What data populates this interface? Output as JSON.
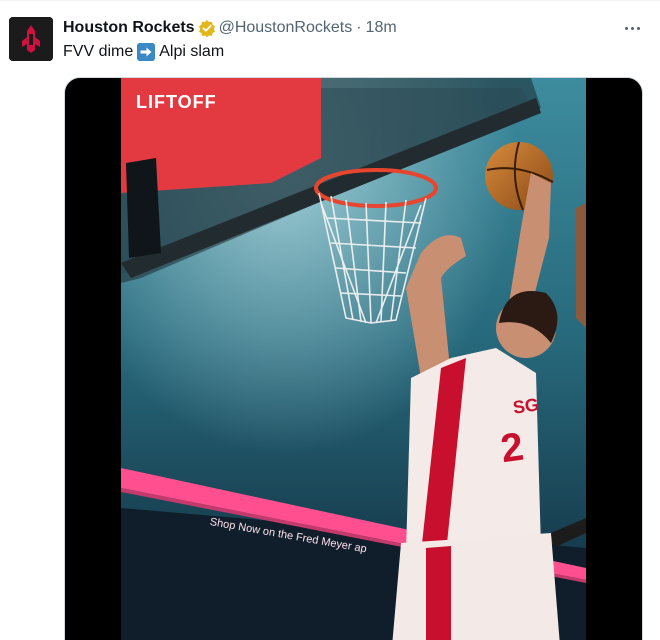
{
  "tweet": {
    "display_name": "Houston Rockets",
    "handle": "@HoustonRockets",
    "separator": "·",
    "time": "18m",
    "text_before": "FVV dime",
    "text_after": "Alpi slam"
  },
  "icons": {
    "avatar": "rockets-logo-icon",
    "verified": "verified-badge-icon",
    "more": "more-options-icon",
    "emoji": "right-arrow-emoji-icon"
  },
  "media": {
    "overlay_logo": "LIFTOFF",
    "ad_banner": "Shop Now on the Fred Meyer ap",
    "jersey_name": "SG",
    "jersey_number": "2"
  },
  "colors": {
    "brand": "#ce1141",
    "verified": "#e2b719",
    "muted_text": "#536471"
  }
}
